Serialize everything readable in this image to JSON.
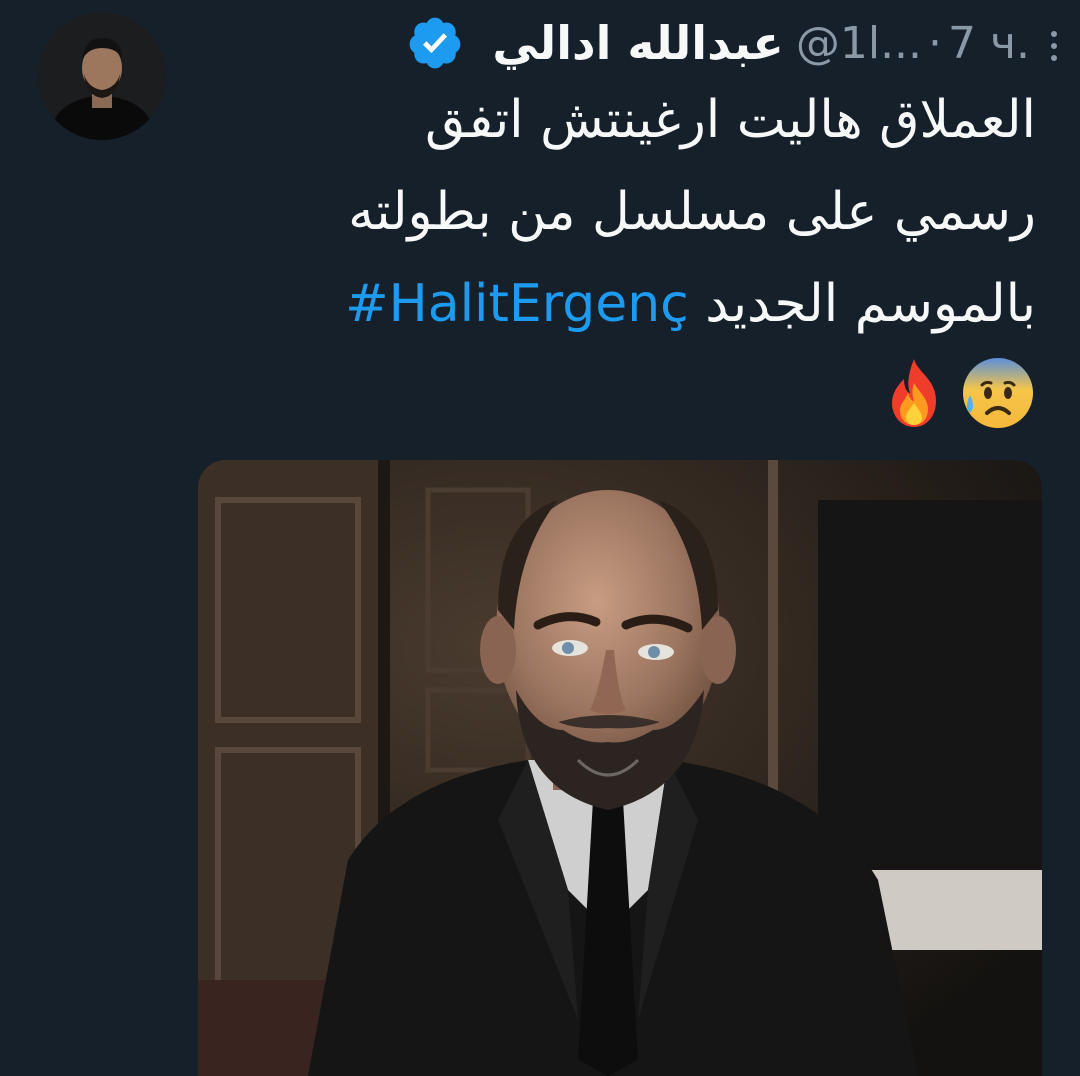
{
  "tweet": {
    "display_name": "عبدالله ادالي",
    "handle": "@1l...",
    "separator": "·",
    "time": "7 ч.",
    "text_lines": [
      "العملاق هاليت ارغينتش اتفق",
      "رسمي على مسلسل من بطولته",
      "بالموسم الجديد"
    ],
    "hashtag": "#HalitErgenç",
    "emojis": [
      "fire-emoji",
      "anxious-face-with-sweat-emoji"
    ],
    "icons": {
      "verified": "verified-badge-icon",
      "more": "more-options-icon"
    }
  },
  "colors": {
    "background": "#15202b",
    "text": "#f7f9f9",
    "secondary": "#8b98a5",
    "accent": "#1d9bf0"
  }
}
